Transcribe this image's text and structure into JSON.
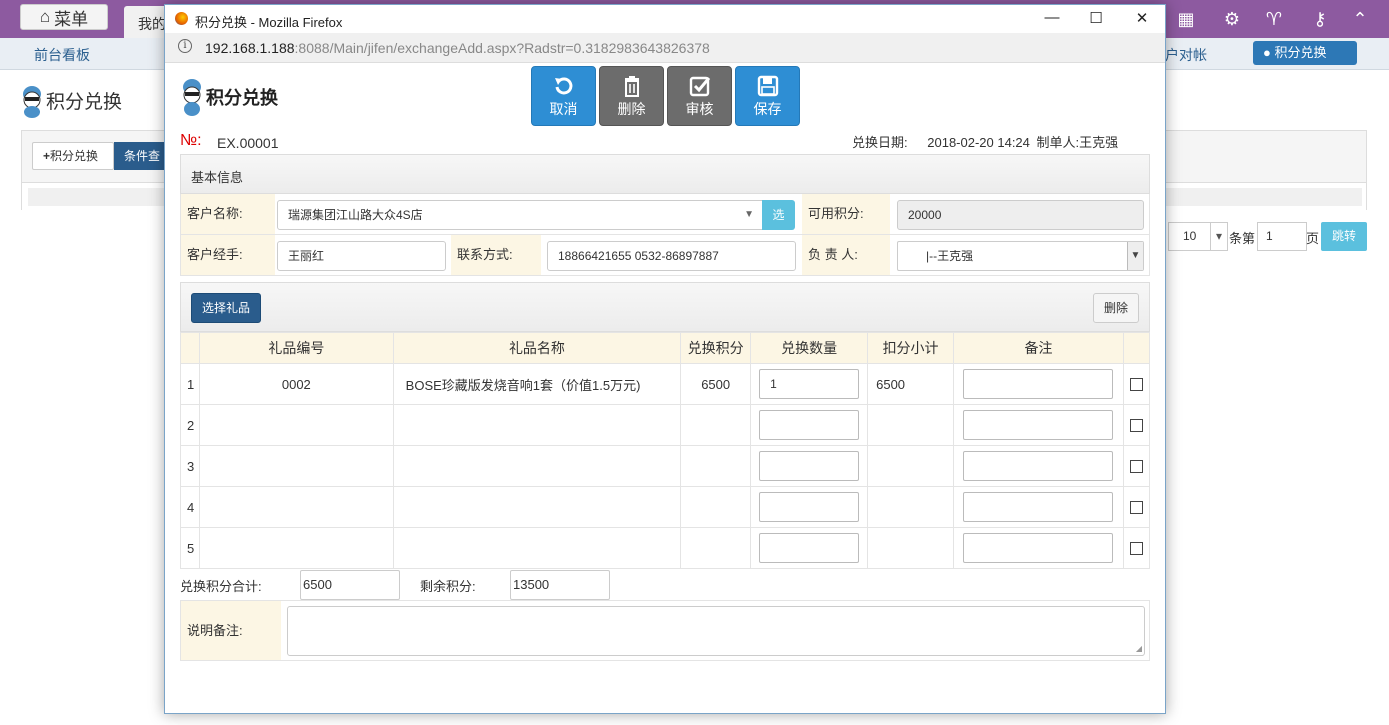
{
  "app": {
    "menu_label": "菜单",
    "tab_label": "我的",
    "nav": [
      "前台看板",
      "户对帐"
    ],
    "nav_active": "积分兑换",
    "page_title": "积分兑换",
    "add_button": "积分兑换",
    "query_button": "条件查",
    "pager": {
      "page_size": "10",
      "label_count": "条第",
      "page": "1",
      "label_page": "页",
      "jump": "跳转"
    }
  },
  "window": {
    "title": "积分兑换 - Mozilla Firefox",
    "url_host": "192.168.1.188",
    "url_rest": ":8088/Main/jifen/exchangeAdd.aspx?Radstr=0.3182983643826378"
  },
  "form": {
    "title": "积分兑换",
    "toolbar": {
      "cancel": "取消",
      "delete": "删除",
      "approve": "审核",
      "save": "保存"
    },
    "no_label": "№:",
    "no_value": "EX.00001",
    "date_label": "兑换日期:",
    "date_value": "2018-02-20 14:24",
    "creator_label": "制单人:",
    "creator_value": "王克强",
    "basic_header": "基本信息",
    "customer_label": "客户名称:",
    "customer_value": "瑞源集团江山路大众4S店",
    "pick_label": "选",
    "points_label": "可用积分:",
    "points_value": "20000",
    "handler_label": "客户经手:",
    "handler_value": "王丽红",
    "contact_label": "联系方式:",
    "contact_value": "18866421655 0532-86897887",
    "owner_label": "负 责 人:",
    "owner_value": "|--王克强",
    "pick_gift": "选择礼品",
    "delete_row": "删除",
    "columns": [
      "礼品编号",
      "礼品名称",
      "兑换积分",
      "兑换数量",
      "扣分小计",
      "备注"
    ],
    "rows": [
      {
        "no": "1",
        "code": "0002",
        "name": "BOSE珍藏版发烧音响1套（价值1.5万元)",
        "points": "6500",
        "qty": "1",
        "subtotal": "6500"
      },
      {
        "no": "2",
        "code": "",
        "name": "",
        "points": "",
        "qty": "",
        "subtotal": ""
      },
      {
        "no": "3",
        "code": "",
        "name": "",
        "points": "",
        "qty": "",
        "subtotal": ""
      },
      {
        "no": "4",
        "code": "",
        "name": "",
        "points": "",
        "qty": "",
        "subtotal": ""
      },
      {
        "no": "5",
        "code": "",
        "name": "",
        "points": "",
        "qty": "",
        "subtotal": ""
      }
    ],
    "total_label": "兑换积分合计:",
    "total_value": "6500",
    "remain_label": "剩余积分:",
    "remain_value": "13500",
    "note_label": "说明备注:"
  },
  "colors": {
    "purple": "#8d5aa0",
    "blue_btn": "#2e8ed4",
    "grey_btn": "#6c6c6c",
    "label_bg": "#fcf6e4",
    "info_btn": "#5bc0de"
  }
}
